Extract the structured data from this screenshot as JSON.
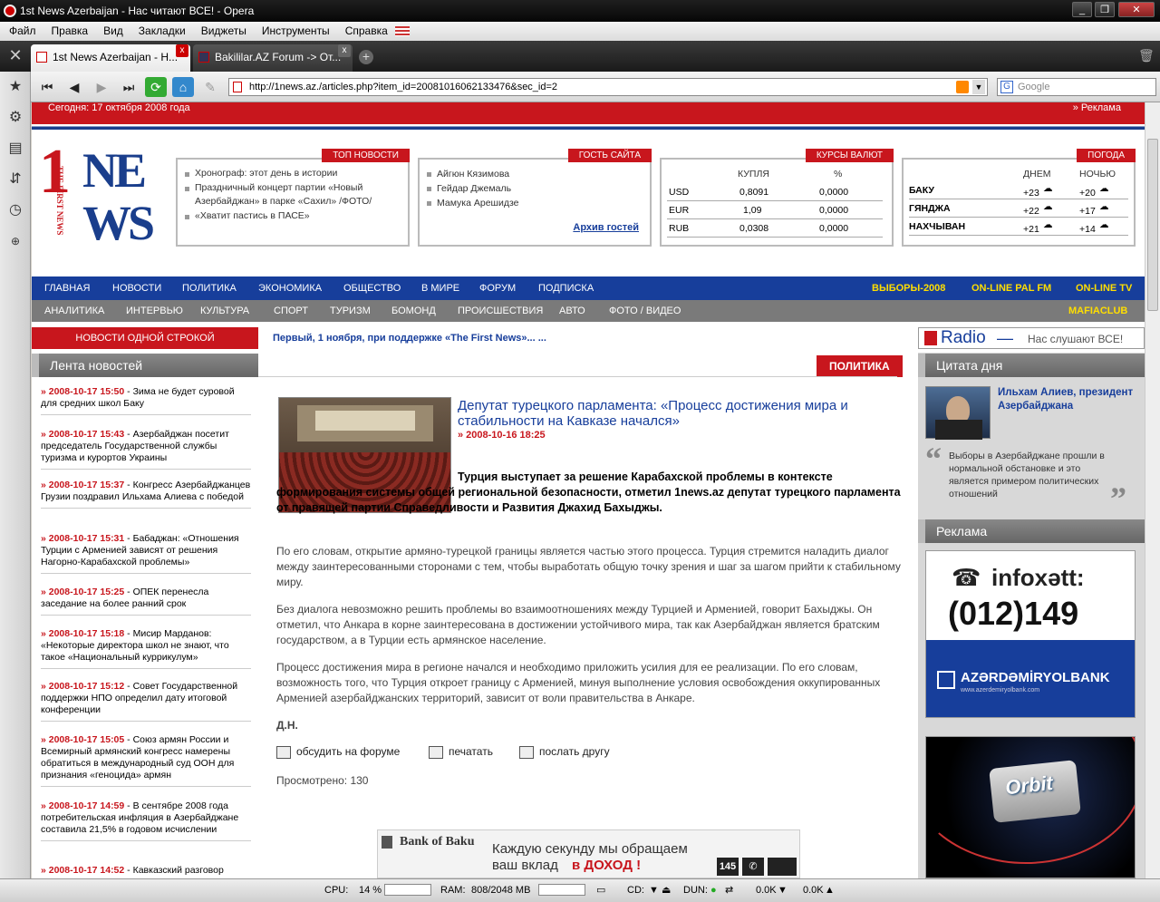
{
  "window": {
    "title": "1st News Azerbaijan - Нас читают ВСЕ! - Opera"
  },
  "menu": [
    "Файл",
    "Правка",
    "Вид",
    "Закладки",
    "Виджеты",
    "Инструменты",
    "Справка"
  ],
  "tabs": [
    {
      "label": "1st News Azerbaijan - Н...",
      "active": true
    },
    {
      "label": "Bakililar.AZ Forum -> От...",
      "active": false
    }
  ],
  "address": {
    "url": "http://1news.az./articles.php?item_id=20081016062133476&sec_id=2",
    "search_placeholder": "Google"
  },
  "site": {
    "today": "Сегодня: 17 октября 2008 года",
    "reklama_link": "» Реклама",
    "logo": {
      "digit": "1",
      "ne": "NE",
      "ws": "WS",
      "tagline": "THE FIRST NEWS"
    },
    "top_news": {
      "title": "ТОП НОВОСТИ",
      "items": [
        "Хронограф: этот день в истории",
        "Праздничный концерт партии «Новый Азербайджан» в парке «Сахил» /ФОТО/",
        "«Хватит пастись в ПАСЕ»"
      ]
    },
    "guest": {
      "title": "ГОСТЬ САЙТА",
      "items": [
        "Айгюн Кязимова",
        "Гейдар Джемаль",
        "Мамука Арешидзе"
      ],
      "archive": "Архив гостей"
    },
    "rates": {
      "title": "КУРСЫ ВАЛЮТ",
      "col_buy": "КУПЛЯ",
      "col_pct": "%",
      "rows": [
        {
          "cur": "USD",
          "buy": "0,8091",
          "pct": "0,0000"
        },
        {
          "cur": "EUR",
          "buy": "1,09",
          "pct": "0,0000"
        },
        {
          "cur": "RUB",
          "buy": "0,0308",
          "pct": "0,0000"
        }
      ]
    },
    "weather": {
      "title": "ПОГОДА",
      "col_day": "ДНЕМ",
      "col_night": "НОЧЬЮ",
      "rows": [
        {
          "city": "БАКУ",
          "day": "+23",
          "night": "+20"
        },
        {
          "city": "ГЯНДЖА",
          "day": "+22",
          "night": "+17"
        },
        {
          "city": "НАХЧЫВАН",
          "day": "+21",
          "night": "+14"
        }
      ]
    },
    "nav1": [
      "ГЛАВНАЯ",
      "НОВОСТИ",
      "ПОЛИТИКА",
      "ЭКОНОМИКА",
      "ОБЩЕСТВО",
      "В МИРЕ",
      "ФОРУМ",
      "ПОДПИСКА"
    ],
    "nav1_highlight": [
      "ВЫБОРЫ-2008",
      "ON-LINE PAL FM",
      "ON-LINE TV"
    ],
    "nav2": [
      "АНАЛИТИКА",
      "ИНТЕРВЬЮ",
      "КУЛЬТУРА",
      "СПОРТ",
      "ТУРИЗМ",
      "БОМОНД",
      "ПРОИСШЕСТВИЯ",
      "АВТО",
      "ФОТО / ВИДЕО"
    ],
    "nav2_highlight": "MAFIACLUB",
    "one_line_label": "НОВОСТИ ОДНОЙ СТРОКОЙ",
    "one_line_text": "Первый, 1 ноября, при поддержке «The First News»... ...",
    "radio": {
      "brand": "Radio",
      "slogan": "Нас слушают ВСЕ!"
    }
  },
  "news_feed": {
    "title": "Лента новостей",
    "items": [
      {
        "date": "» 2008-10-17 15:50",
        "text": " - Зима не будет суровой для средних школ Баку"
      },
      {
        "date": "» 2008-10-17 15:43",
        "text": " - Азербайджан посетит председатель Государственной службы туризма и курортов Украины"
      },
      {
        "date": "» 2008-10-17 15:37",
        "text": " - Конгресс Азербайджанцев Грузии поздравил Ильхама Алиева с победой"
      },
      {
        "date": "» 2008-10-17 15:31",
        "text": " - Бабаджан: «Отношения Турции с Арменией зависят от решения Нагорно-Карабахской проблемы»"
      },
      {
        "date": "» 2008-10-17 15:25",
        "text": " - ОПЕК перенесла заседание на более ранний срок"
      },
      {
        "date": "» 2008-10-17 15:18",
        "text": " - Мисир Марданов: «Некоторые директора школ не знают, что такое «Национальный куррикулум»"
      },
      {
        "date": "» 2008-10-17 15:12",
        "text": " - Совет Государственной поддержки НПО определил дату итоговой конференции"
      },
      {
        "date": "» 2008-10-17 15:05",
        "text": " - Союз армян России и Всемирный армянский конгресс намерены обратиться в международный суд ООН для признания «геноцида» армян"
      },
      {
        "date": "» 2008-10-17 14:59",
        "text": " - В сентябре 2008 года потребительская инфляция в Азербайджане составила 21,5% в годовом исчислении"
      },
      {
        "date": "» 2008-10-17 14:52",
        "text": " - Кавказский разговор"
      }
    ]
  },
  "article": {
    "section": "ПОЛИТИКА",
    "title": "Депутат турецкого парламента: «Процесс достижения мира и стабильности на Кавказе начался»",
    "date": "» 2008-10-16 18:25",
    "lead": "Турция выступает за решение Карабахской проблемы в контексте формирования системы общей региональной безопасности, отметил 1news.az депутат турецкого парламента от правящей партии Справедливости и Развития Джахид Бахыджы.",
    "paragraphs": [
      "По его словам, открытие армяно-турецкой границы является частью этого процесса. Турция стремится наладить диалог между заинтересованными сторонами с тем, чтобы выработать общую точку зрения и шаг за шагом прийти к стабильному миру.",
      "Без диалога невозможно решить проблемы во взаимоотношениях между Турцией и Арменией, говорит Бахыджы. Он отметил, что Анкара в корне заинтересована в достижении устойчивого мира, так как Азербайджан является братским государством, а в Турции есть армянское население.",
      "Процесс достижения мира в регионе начался и необходимо приложить усилия для ее реализации. По его словам, возможность того, что Турция откроет границу с Арменией, минуя выполнение условия освобождения оккупированных Арменией азербайджанских территорий, зависит от воли правительства в Анкаре."
    ],
    "author": "Д.Н.",
    "actions": [
      "обсудить на форуме",
      "печатать",
      "послать другу"
    ],
    "views": "Просмотрено: 130"
  },
  "bank_banner": {
    "brand": "Bank of Baku",
    "line1": "Каждую секунду мы обращаем",
    "line2a": "ваш вклад",
    "line2b": "в ДОХОД !",
    "number": "145"
  },
  "quote": {
    "title": "Цитата дня",
    "author": "Ильхам Алиев, президент Азербайджана",
    "text": "Выборы в Азербайджане прошли в нормальной обстановке и это является примером политических отношений"
  },
  "ads": {
    "title": "Реклама",
    "infoxett": "infoxətt:",
    "phone": "(012)149",
    "bank": "AZƏRDƏMİRYOLBANK",
    "bank_url": "www.azerdemiryolbank.com",
    "orbit": "Orbit"
  },
  "status": {
    "cpu_label": "CPU:",
    "cpu_val": "14 %",
    "ram_label": "RAM:",
    "ram_val": "808/2048 MB",
    "cd_label": "CD:",
    "dun_label": "DUN:",
    "down": "0.0K",
    "up": "0.0K"
  },
  "colors": {
    "red": "#c8161d",
    "blue": "#173e9b",
    "yellow": "#ffde00"
  }
}
